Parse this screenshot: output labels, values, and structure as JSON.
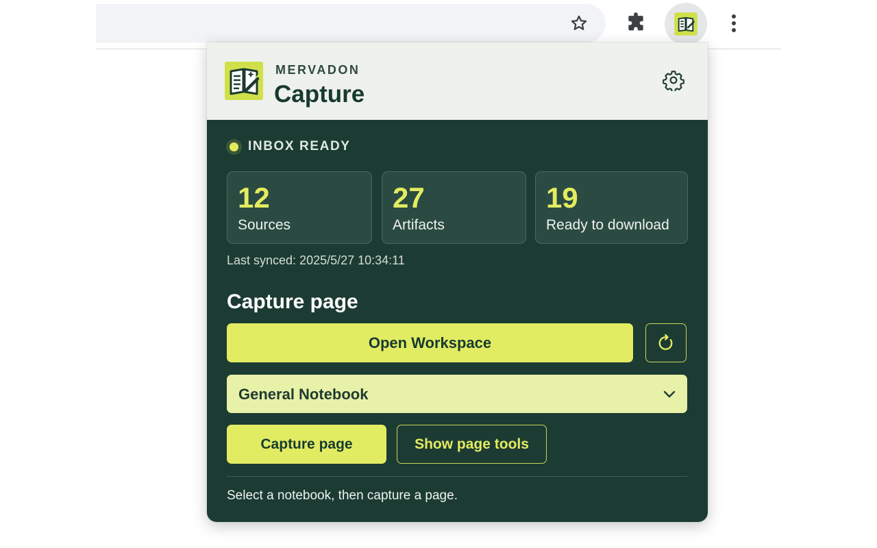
{
  "browser": {
    "icons": {
      "bookmark": "star-icon",
      "extensions": "puzzle-icon",
      "extension_active": "notebook-icon",
      "menu": "kebab-menu-icon"
    }
  },
  "popup": {
    "brand": "MERVADON",
    "title": "Capture",
    "settings_icon": "gear-icon",
    "status": {
      "label": "INBOX READY",
      "color": "#e2ec5e"
    },
    "stats": [
      {
        "value": "12",
        "label": "Sources"
      },
      {
        "value": "27",
        "label": "Artifacts"
      },
      {
        "value": "19",
        "label": "Ready to download"
      }
    ],
    "last_synced": "Last synced: 2025/5/27 10:34:11",
    "section_title": "Capture page",
    "open_workspace_label": "Open Workspace",
    "refresh_icon": "refresh-icon",
    "notebook_select": {
      "value": "General Notebook",
      "icon": "chevron-down-icon"
    },
    "capture_button_label": "Capture page",
    "page_tools_button_label": "Show page tools",
    "hint": "Select a notebook, then capture a page."
  },
  "colors": {
    "panel_bg": "#1c3b33",
    "header_bg": "#eef1ec",
    "accent": "#e2ec63",
    "select_bg": "#e8f1a8"
  }
}
